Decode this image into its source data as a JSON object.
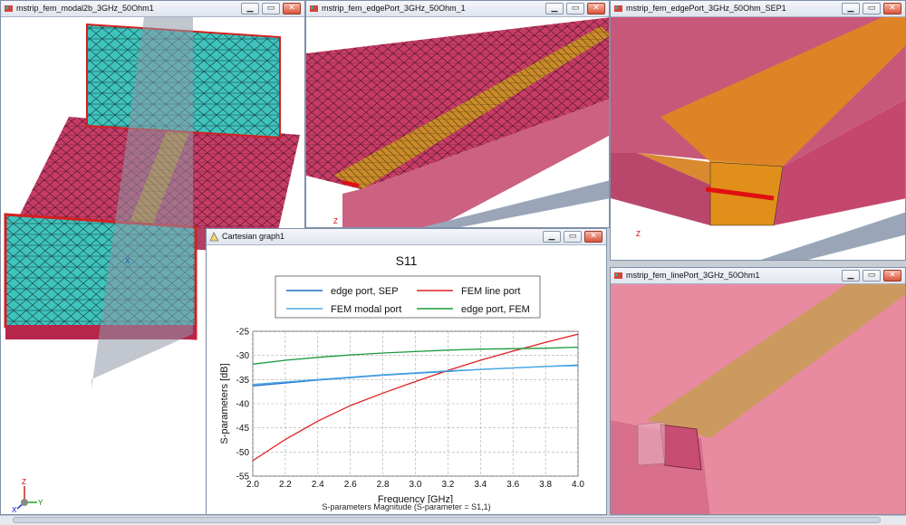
{
  "windows": {
    "modal": {
      "title": "mstrip_fem_modal2b_3GHz_50Ohm1"
    },
    "edge1": {
      "title": "mstrip_fem_edgePort_3GHz_50Ohm_1"
    },
    "sep": {
      "title": "mstrip_fem_edgePort_3GHz_50Ohm_SEP1"
    },
    "line": {
      "title": "mstrip_fem_linePort_3GHz_50Ohm1"
    },
    "graph": {
      "title": "Cartesian graph1"
    }
  },
  "window_buttons": {
    "minimize": "▁",
    "restore": "▭",
    "close": "✕"
  },
  "triad": {
    "x": "X",
    "y": "Y",
    "z": "Z"
  },
  "chart_data": {
    "type": "line",
    "title": "S11",
    "xlabel": "Frequency [GHz]",
    "ylabel": "S-parameters [dB]",
    "footer": "S-parameters Magnitude (S-parameter = S1,1)",
    "xlim": [
      2.0,
      4.0
    ],
    "ylim": [
      -55,
      -25
    ],
    "xticks": [
      "2.0",
      "2.2",
      "2.4",
      "2.6",
      "2.8",
      "3.0",
      "3.2",
      "3.4",
      "3.6",
      "3.8",
      "4.0"
    ],
    "yticks": [
      "-25",
      "-30",
      "-35",
      "-40",
      "-45",
      "-50",
      "-55"
    ],
    "grid": true,
    "legend_position": "top",
    "x": [
      2.0,
      2.2,
      2.4,
      2.6,
      2.8,
      3.0,
      3.2,
      3.4,
      3.6,
      3.8,
      4.0
    ],
    "series": [
      {
        "name": "edge port, SEP",
        "color": "#1a6fd0",
        "values": [
          -36.3,
          -35.7,
          -35.1,
          -34.6,
          -34.1,
          -33.7,
          -33.3,
          -32.9,
          -32.6,
          -32.3,
          -32.0
        ]
      },
      {
        "name": "FEM line port",
        "color": "#e02020",
        "values": [
          -51.8,
          -47.4,
          -43.6,
          -40.4,
          -37.8,
          -35.4,
          -33.1,
          -31.0,
          -29.1,
          -27.3,
          -25.6
        ]
      },
      {
        "name": "FEM modal port",
        "color": "#48a8e6",
        "values": [
          -36.0,
          -35.5,
          -35.0,
          -34.5,
          -34.0,
          -33.6,
          -33.2,
          -32.9,
          -32.6,
          -32.3,
          -32.1
        ]
      },
      {
        "name": "edge port, FEM",
        "color": "#1c9a3c",
        "values": [
          -31.8,
          -31.0,
          -30.4,
          -29.9,
          -29.5,
          -29.2,
          -28.9,
          -28.7,
          -28.6,
          -28.5,
          -28.3
        ]
      }
    ]
  }
}
